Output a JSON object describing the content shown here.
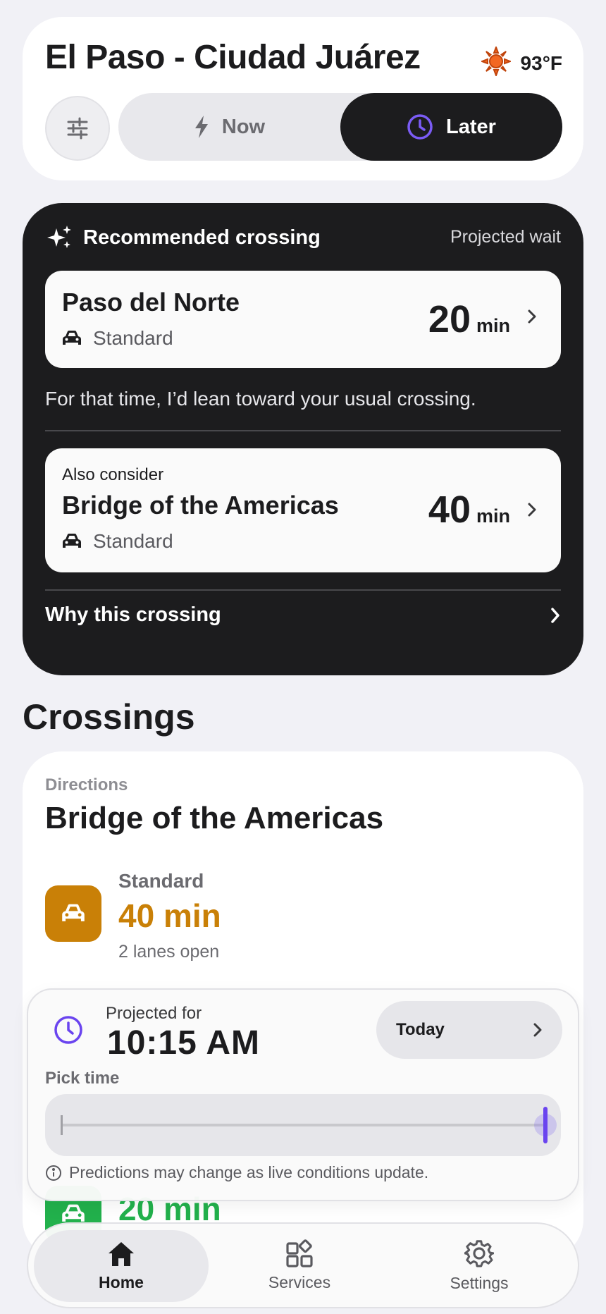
{
  "header": {
    "city": "El Paso - Ciudad Juárez",
    "temperature": "93°F",
    "mode": {
      "now_label": "Now",
      "later_label": "Later",
      "selected": "Later"
    }
  },
  "recommendation": {
    "title": "Recommended crossing",
    "projected_label": "Projected wait",
    "primary": {
      "name": "Paso del Norte",
      "lane_type": "Standard",
      "wait": "20",
      "unit": "min"
    },
    "note": "For that time, I’d lean toward your usual crossing.",
    "alternate": {
      "prefix": "Also consider",
      "name": "Bridge of the Americas",
      "lane_type": "Standard",
      "wait": "40",
      "unit": "min"
    },
    "why_label": "Why this crossing"
  },
  "crossings": {
    "section_title": "Crossings",
    "card": {
      "directions_label": "Directions",
      "name": "Bridge of the Americas",
      "lane_type": "Standard",
      "wait": "40 min",
      "lanes_open": "2 lanes open",
      "second_wait": "20 min"
    }
  },
  "projection": {
    "projected_for_label": "Projected for",
    "time": "10:15 AM",
    "day_label": "Today",
    "pick_time_label": "Pick time",
    "slider_position": 1.0,
    "disclaimer": "Predictions may change as live conditions update."
  },
  "tabbar": {
    "home": "Home",
    "services": "Services",
    "settings": "Settings",
    "active": "Home"
  },
  "colors": {
    "accent_purple": "#6a44ef",
    "wait_amber": "#c98007",
    "wait_green": "#22b14c",
    "dark_card": "#1c1c1e",
    "sun": "#f26722"
  }
}
